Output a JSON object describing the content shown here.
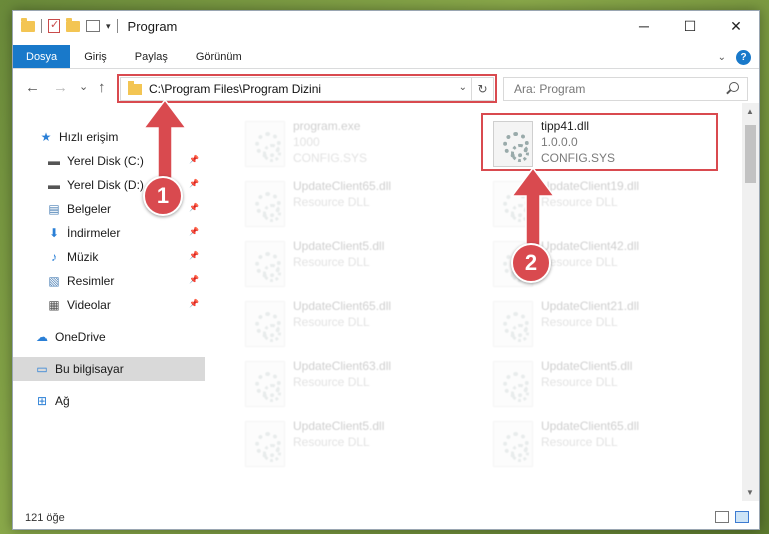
{
  "window": {
    "title": "Program",
    "minimize": "─",
    "maximize": "☐",
    "close": "✕"
  },
  "ribbon": {
    "tabs": [
      "Dosya",
      "Giriş",
      "Paylaş",
      "Görünüm"
    ]
  },
  "nav": {
    "back": "←",
    "forward": "→",
    "recent": "⌄",
    "up": "↑"
  },
  "address": {
    "path": "C:\\Program Files\\Program Dizini",
    "refresh": "↻",
    "dropdown": "⌄"
  },
  "search": {
    "placeholder": "Ara: Program"
  },
  "sidebar": {
    "items": [
      {
        "label": "Hızlı erişim",
        "icon": "star-icon",
        "glyph": "★",
        "color": "#2a7fd6"
      },
      {
        "label": "Yerel Disk (C:)",
        "icon": "drive-icon",
        "glyph": "▬",
        "color": "#555"
      },
      {
        "label": "Yerel Disk (D:)",
        "icon": "drive-icon",
        "glyph": "▬",
        "color": "#555"
      },
      {
        "label": "Belgeler",
        "icon": "documents-icon",
        "glyph": "▤",
        "color": "#4a7fb5"
      },
      {
        "label": "İndirmeler",
        "icon": "download-icon",
        "glyph": "⬇",
        "color": "#2a7fd6"
      },
      {
        "label": "Müzik",
        "icon": "music-icon",
        "glyph": "♪",
        "color": "#2a7fd6"
      },
      {
        "label": "Resimler",
        "icon": "pictures-icon",
        "glyph": "▧",
        "color": "#4a7fb5"
      },
      {
        "label": "Videolar",
        "icon": "videos-icon",
        "glyph": "▦",
        "color": "#555"
      },
      {
        "label": "OneDrive",
        "icon": "cloud-icon",
        "glyph": "☁",
        "color": "#2a7fd6"
      },
      {
        "label": "Bu bilgisayar",
        "icon": "computer-icon",
        "glyph": "▭",
        "color": "#2a7fd6"
      },
      {
        "label": "Ağ",
        "icon": "network-icon",
        "glyph": "⊞",
        "color": "#2a7fd6"
      }
    ]
  },
  "files": [
    {
      "name": "program.exe",
      "sub1": "1000",
      "sub2": "CONFIG.SYS",
      "faded": true
    },
    {
      "name": "tipp41.dll",
      "sub1": "1.0.0.0",
      "sub2": "CONFIG.SYS",
      "faded": false
    },
    {
      "name": "UpdateClient65.dll",
      "sub1": "Resource DLL",
      "sub2": "",
      "faded": true
    },
    {
      "name": "UpdateClient19.dll",
      "sub1": "Resource DLL",
      "sub2": "",
      "faded": true
    },
    {
      "name": "UpdateClient5.dll",
      "sub1": "Resource DLL",
      "sub2": "",
      "faded": true
    },
    {
      "name": "UpdateClient42.dll",
      "sub1": "Resource DLL",
      "sub2": "",
      "faded": true
    },
    {
      "name": "UpdateClient65.dll",
      "sub1": "Resource DLL",
      "sub2": "",
      "faded": true
    },
    {
      "name": "UpdateClient21.dll",
      "sub1": "Resource DLL",
      "sub2": "",
      "faded": true
    },
    {
      "name": "UpdateClient63.dll",
      "sub1": "Resource DLL",
      "sub2": "",
      "faded": true
    },
    {
      "name": "UpdateClient5.dll",
      "sub1": "Resource DLL",
      "sub2": "",
      "faded": true
    },
    {
      "name": "UpdateClient5.dll",
      "sub1": "Resource DLL",
      "sub2": "",
      "faded": true
    },
    {
      "name": "UpdateClient65.dll",
      "sub1": "Resource DLL",
      "sub2": "",
      "faded": true
    }
  ],
  "status": {
    "count": "121 öğe"
  },
  "callouts": [
    "1",
    "2"
  ],
  "colors": {
    "accent": "#1979ca",
    "highlight": "#d94a4f"
  }
}
